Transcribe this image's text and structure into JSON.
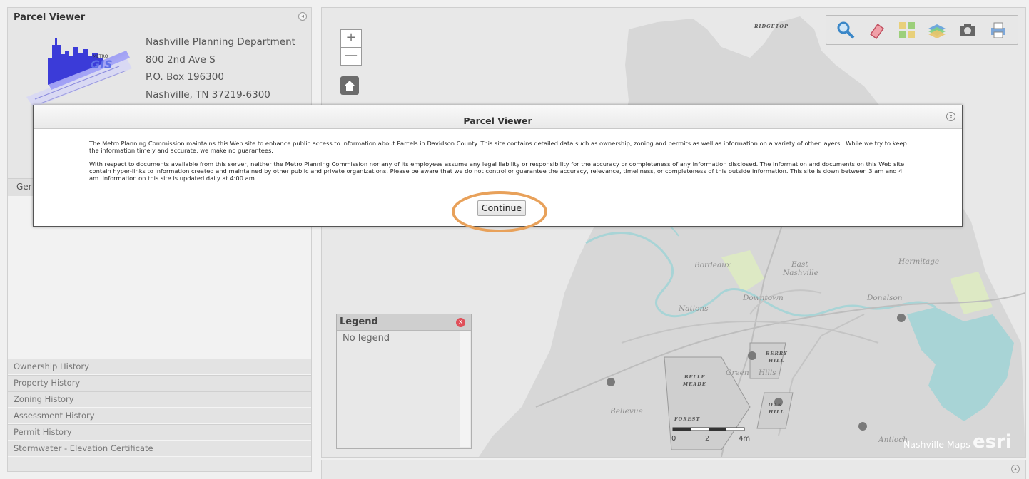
{
  "left_panel": {
    "title": "Parcel Viewer",
    "address": [
      "Nashville Planning Department",
      "800 2nd Ave S",
      "P.O. Box 196300",
      "Nashville, TN 37219-6300"
    ],
    "general_tab": "Ger",
    "history_items": [
      "Ownership History",
      "Property History",
      "Zoning History",
      "Assessment History",
      "Permit History",
      "Stormwater - Elevation Certificate"
    ]
  },
  "map": {
    "zoom_in": "+",
    "zoom_out": "—",
    "labels": {
      "ridgetop": "RIDGETOP",
      "bordeaux": "Bordeaux",
      "east": "East",
      "nashville": "Nashville",
      "hermitage": "Hermitage",
      "downtown": "Downtown",
      "donelson": "Donelson",
      "nations": "Nations",
      "berry": "BERRY",
      "hill": "HILL",
      "belle": "BELLE",
      "meade": "MEADE",
      "green": "Green",
      "hills": "Hills",
      "oak": "OAK",
      "hill2": "HILL",
      "bellevue": "Bellevue",
      "forest": "FOREST",
      "antioch": "Antioch"
    },
    "scale": {
      "label_0": "0",
      "label_2": "2",
      "label_4": "4mi"
    },
    "attribution": "Nashville Maps",
    "esri": "esri"
  },
  "toolbar": {
    "icons": [
      "search-icon",
      "eraser-icon",
      "basemap-icon",
      "layers-icon",
      "camera-icon",
      "print-icon"
    ]
  },
  "legend": {
    "title": "Legend",
    "body": "No legend",
    "close": "x"
  },
  "dialog": {
    "title": "Parcel Viewer",
    "close": "x",
    "paragraph1": "The Metro Planning Commission maintains this Web site to enhance public access to information about Parcels in Davidson County. This site contains detailed data such as ownership, zoning and permits as well as information on a variety of other layers . While we try to keep the information timely and accurate, we make no guarantees.",
    "paragraph2": "With respect to documents available from this server, neither the Metro Planning Commission nor any of its employees assume any legal liability or responsibility for the accuracy or completeness of any information disclosed. The information and documents on this Web site contain hyper-links to information created and maintained by other public and private organizations. Please be aware that we do not control or guarantee the accuracy, relevance, timeliness, or completeness of this outside information. This site is down between 3 am and 4 am. Information on this site is updated daily at 4:00 am.",
    "continue_label": "Continue"
  },
  "colors": {
    "highlight_ring": "#e8a15a",
    "legend_close": "#e0505a",
    "water": "#a8d4d6",
    "park": "#d8e8b8"
  }
}
